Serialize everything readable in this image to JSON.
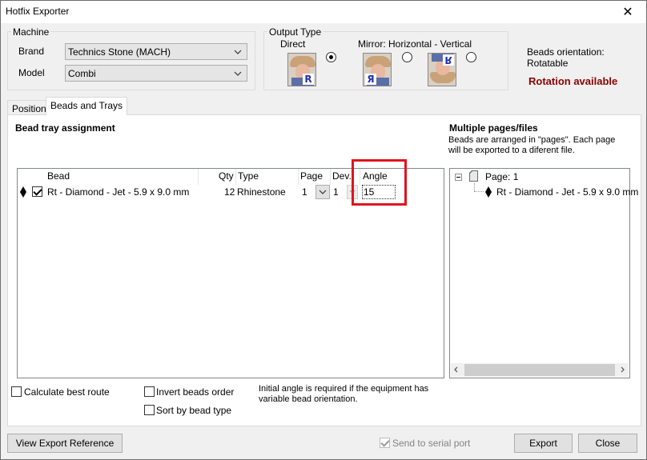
{
  "window": {
    "title": "Hotfix Exporter",
    "close_glyph": "✕"
  },
  "machine": {
    "group_label": "Machine",
    "brand_label": "Brand",
    "brand_value": "Technics Stone (MACH)",
    "model_label": "Model",
    "model_value": "Combi"
  },
  "output_type": {
    "group_label": "Output Type",
    "direct_label": "Direct",
    "mirror_label": "Mirror: Horizontal - Vertical",
    "selected": "direct",
    "thumb_letters": [
      "R",
      "Я",
      "R"
    ]
  },
  "orientation": {
    "label": "Beads orientation: Rotatable",
    "rotation_status": "Rotation available",
    "rotation_color": "#8b0000"
  },
  "tabs": [
    {
      "label": "Position",
      "active": false
    },
    {
      "label": "Beads and Trays",
      "active": true
    }
  ],
  "bead_tray": {
    "heading": "Bead tray assignment",
    "columns": {
      "bead": "Bead",
      "qty": "Qty",
      "type": "Type",
      "page": "Page",
      "dev": "Dev.",
      "angle": "Angle"
    },
    "rows": [
      {
        "checked": true,
        "bead": "Rt - Diamond - Jet - 5.9 x 9.0 mm",
        "qty": "12",
        "type": "Rhinestone",
        "page": "1",
        "dev": "1",
        "angle": "15"
      }
    ]
  },
  "multiple_pages": {
    "heading": "Multiple pages/files",
    "description": "Beads are arranged in \"pages\". Each page will be exported to a diferent file.",
    "tree": {
      "page_label": "Page: 1",
      "child_label": "Rt - Diamond - Jet - 5.9 x 9.0 mm"
    }
  },
  "options": {
    "calculate_best_route": {
      "label": "Calculate best route",
      "checked": false
    },
    "invert_beads_order": {
      "label": "Invert beads order",
      "checked": false
    },
    "sort_by_bead_type": {
      "label": "Sort by bead type",
      "checked": false
    },
    "angle_note": "Initial angle is required if the equipment has variable bead orientation."
  },
  "footer": {
    "view_export_reference": "View Export Reference",
    "send_to_serial_port": {
      "label": "Send to serial port",
      "checked": true,
      "enabled": false
    },
    "export": "Export",
    "close": "Close"
  },
  "colors": {
    "highlight": "#e0141e",
    "accent_blue": "#2233aa"
  }
}
